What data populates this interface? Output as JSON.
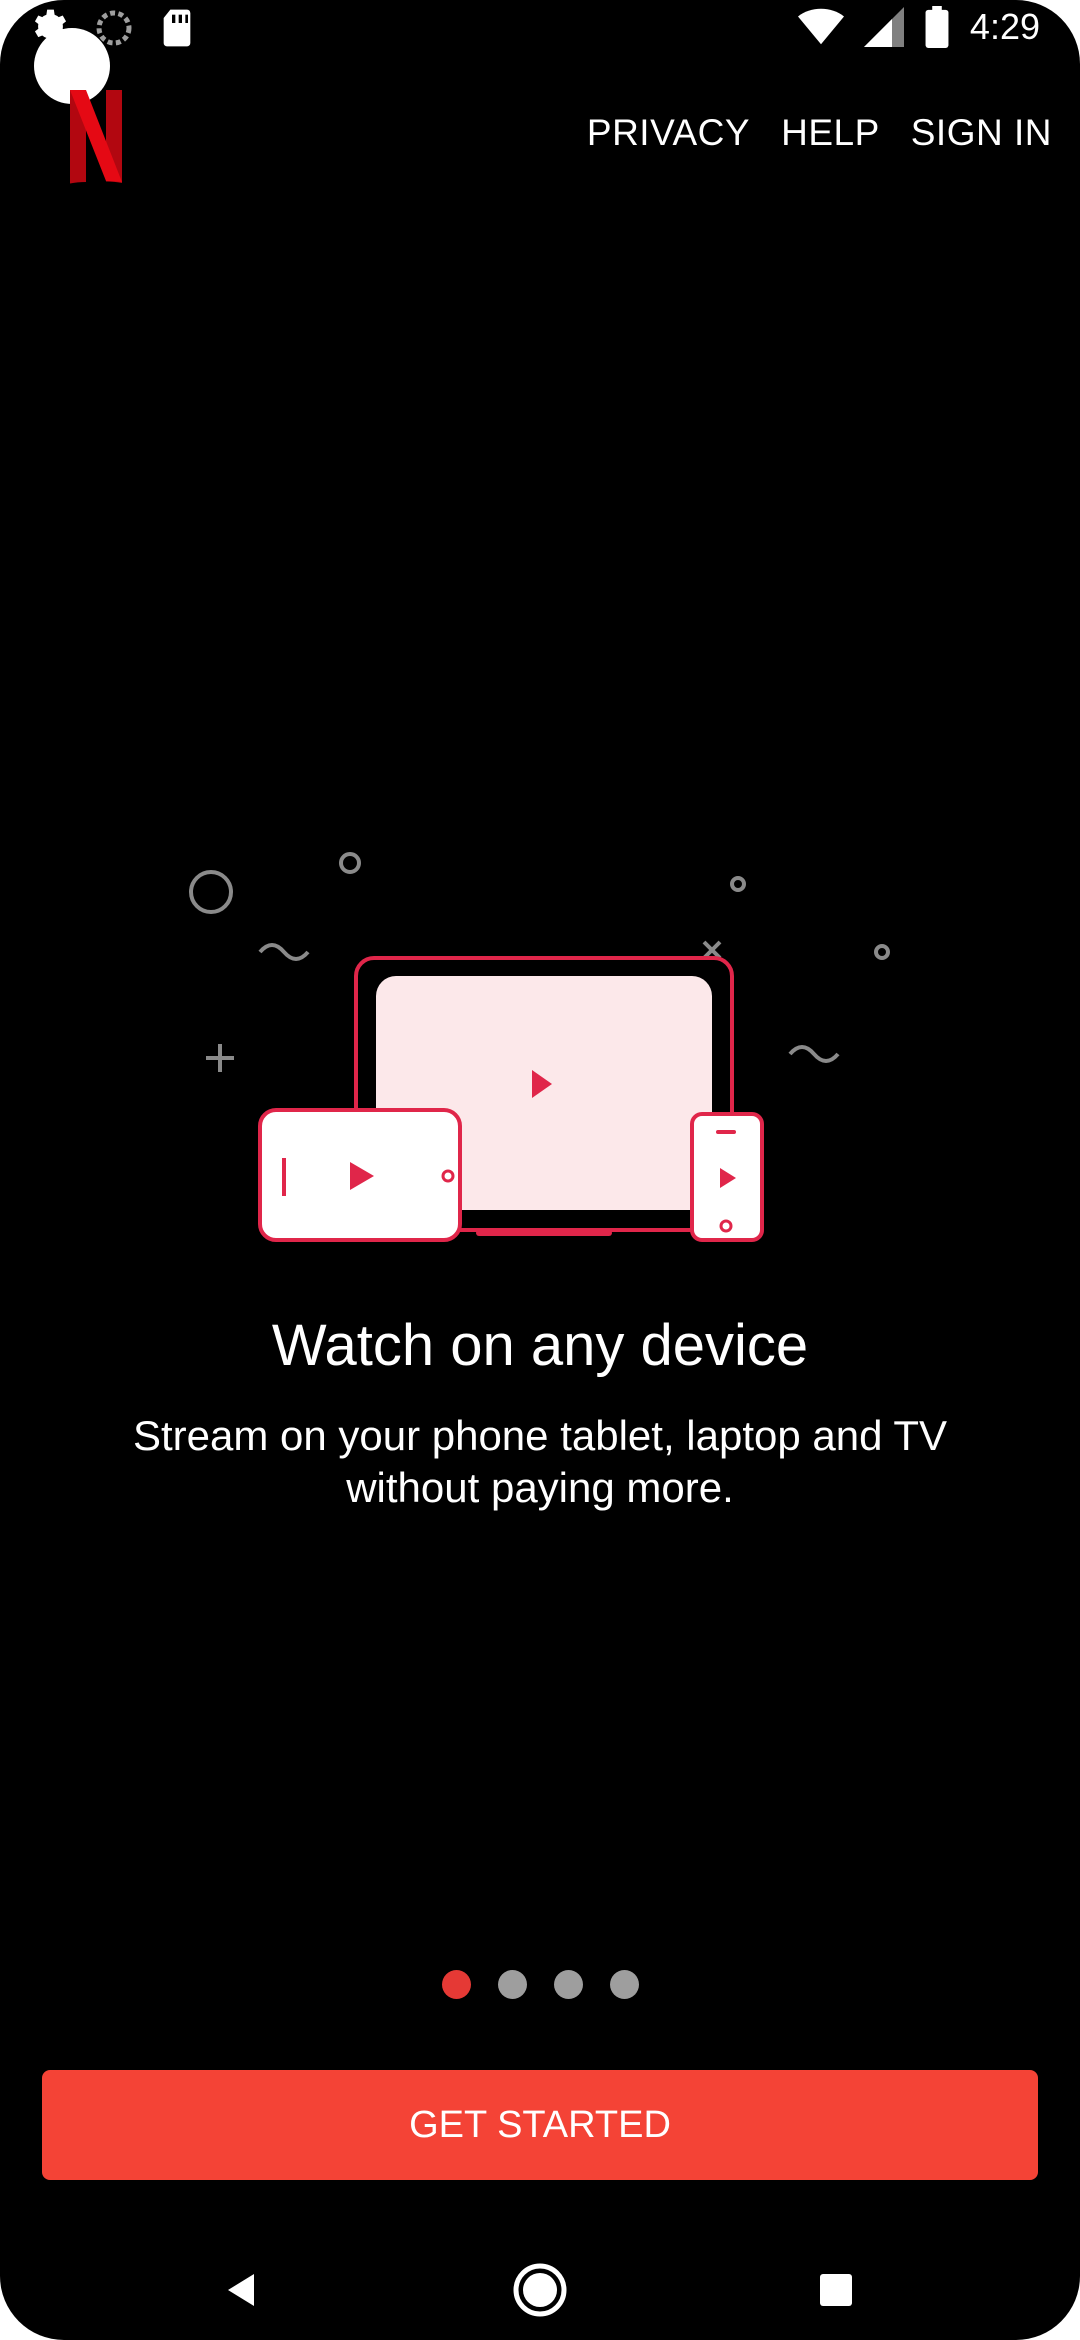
{
  "status_bar": {
    "time": "4:29",
    "icons": [
      "settings-icon",
      "sync-icon",
      "sd-card-icon",
      "wifi-icon",
      "signal-icon",
      "battery-icon"
    ]
  },
  "header": {
    "logo": "netflix-logo",
    "nav": [
      {
        "label": "PRIVACY"
      },
      {
        "label": "HELP"
      },
      {
        "label": "SIGN IN"
      }
    ]
  },
  "onboarding": {
    "title": "Watch on any device",
    "subtitle_line1": "Stream on your phone tablet, laptop and TV",
    "subtitle_line2": "without paying more.",
    "page_index": 1,
    "page_count": 4
  },
  "cta": {
    "label": "GET STARTED"
  },
  "colors": {
    "accent": "#f44336",
    "brand": "#e50914",
    "dot_inactive": "#9e9e9e",
    "background": "#000000"
  },
  "nav_bar": {
    "icons": [
      "back-icon",
      "home-icon",
      "recents-icon"
    ]
  }
}
